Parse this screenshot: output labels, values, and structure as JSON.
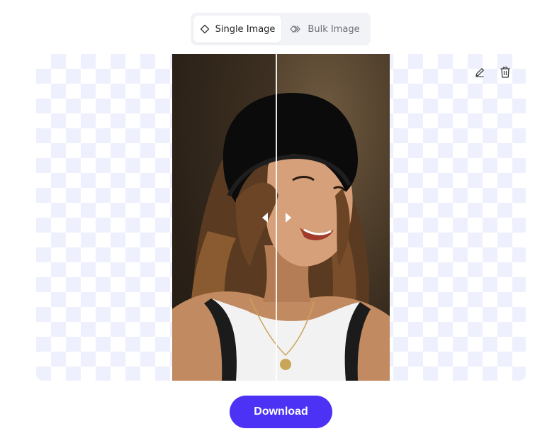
{
  "mode_toggle": {
    "single_label": "Single Image",
    "bulk_label": "Bulk Image",
    "selected": "Single Image"
  },
  "toolbar": {
    "edit_icon": "pencil-icon",
    "delete_icon": "trash-icon"
  },
  "preview": {
    "comparison_handle_icons": [
      "chevron-left-icon",
      "chevron-right-icon"
    ]
  },
  "download_label": "Download",
  "colors": {
    "accent": "#4b32f5",
    "checker": "#eef0fd",
    "toggle_bg": "#f1f3f6"
  }
}
